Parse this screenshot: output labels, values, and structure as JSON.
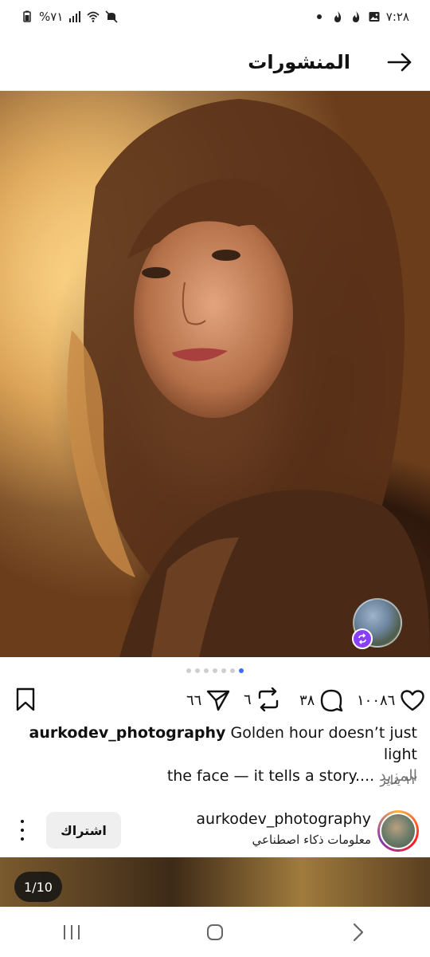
{
  "status_bar": {
    "time": "٧:٢٨",
    "battery": "%٧١",
    "icons_right": [
      "flame-icon",
      "flame-icon",
      "gallery-icon",
      "dot-icon"
    ],
    "icons_left": [
      "battery-icon",
      "signal-icon",
      "wifi-icon",
      "mute-icon"
    ]
  },
  "header": {
    "title": "المنشورات"
  },
  "post": {
    "image_count": 7,
    "active_index": 6,
    "likes": "١٠٠٨٦",
    "comments": "٣٨",
    "reposts": "٦",
    "shares": "٦٦",
    "username": "aurkodev_photography",
    "caption_line1": "Golden hour doesn’t just light",
    "caption_line2": "the face — it tells a story....",
    "more_label": "المزيد",
    "date": "١٢ يناير"
  },
  "next_post": {
    "username": "aurkodev_photography",
    "subtitle": "معلومات ذكاء اصطناعي",
    "subscribe_label": "اشتراك",
    "counter": "1/10"
  },
  "colors": {
    "accent": "#3d6aff",
    "badge": "#8a3ffc"
  }
}
